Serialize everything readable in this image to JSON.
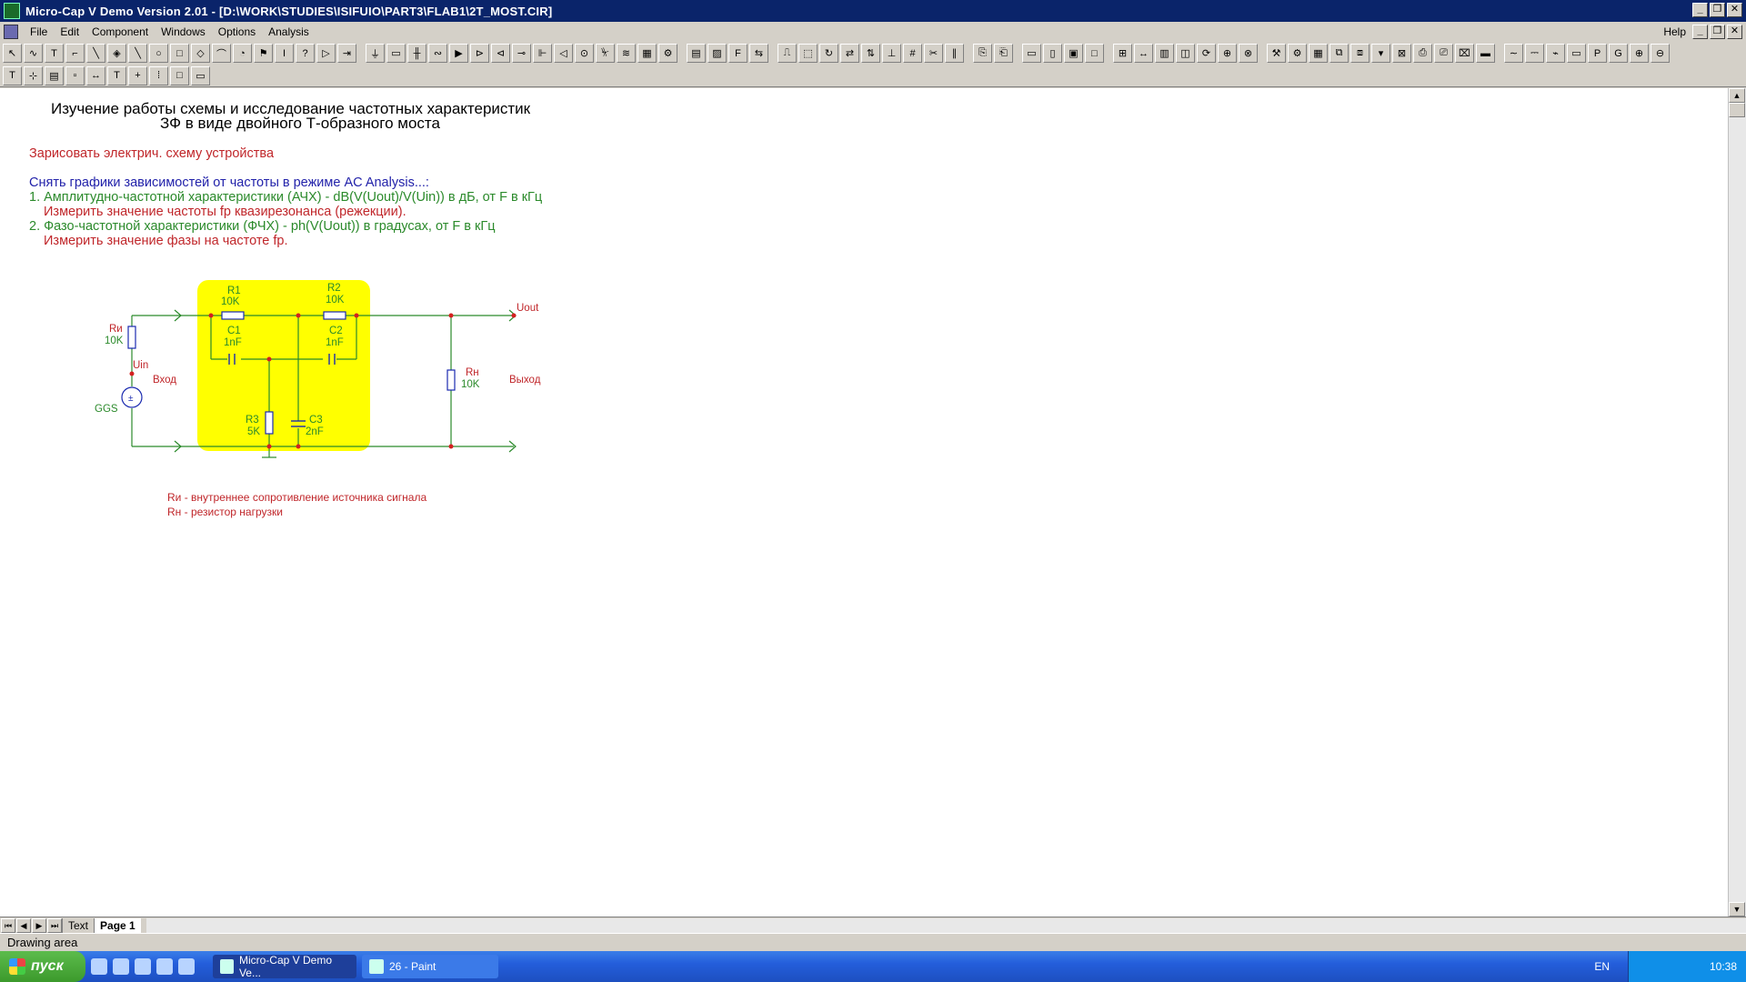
{
  "window": {
    "title": "Micro-Cap V Demo Version 2.01 - [D:\\WORK\\STUDIES\\ISIFUIO\\PART3\\FLAB1\\2T_MOST.CIR]"
  },
  "menu": {
    "items": [
      "File",
      "Edit",
      "Component",
      "Windows",
      "Options",
      "Analysis"
    ],
    "help": "Help"
  },
  "document": {
    "title_line1": "Изучение работы схемы и исследование частотных характеристик",
    "title_line2": "ЗФ в виде двойного Т-образного моста",
    "instruction_draw": "Зарисовать электрич. схему устройства",
    "instruction_graphs": "Снять графики зависимостей от частоты в режиме AC Analysis...:",
    "item1": "1. Амплитудно-частотной характеристики (АЧХ) - dB(V(Uout)/V(Uin)) в дБ, от F в кГц",
    "item1_sub": "Измерить значение частоты fр квазирезонанса (режекции).",
    "item2": "2. Фазо-частотной характеристики (ФЧХ) - ph(V(Uout)) в градусах, от F в кГц",
    "item2_sub": "Измерить значение фазы на частоте fр.",
    "note1": "Rи - внутреннее сопротивление источника сигнала",
    "note2": "Rн - резистор нагрузки"
  },
  "schematic": {
    "r1_name": "R1",
    "r1_value": "10K",
    "r2_name": "R2",
    "r2_value": "10K",
    "c1_name": "C1",
    "c1_value": "1nF",
    "c2_name": "C2",
    "c2_value": "1nF",
    "r3_name": "R3",
    "r3_value": "5K",
    "c3_name": "C3",
    "c3_value": "2nF",
    "ri_name": "Rи",
    "ri_value": "10K",
    "rn_name": "Rн",
    "rn_value": "10K",
    "uin": "Uin",
    "uout": "Uout",
    "vhod": "Вход",
    "vyhod": "Выход",
    "source": "GGS",
    "colors": {
      "wire": "#2b8a2b",
      "highlight": "#ffff00",
      "node": "#d42020",
      "component": "#1a2ab0",
      "label": "#2b8a2b"
    }
  },
  "tabs": {
    "text": "Text",
    "page": "Page 1"
  },
  "status": "Drawing area",
  "taskbar": {
    "start": "пуск",
    "task1": "Micro-Cap V Demo Ve...",
    "task2": "26 - Paint",
    "lang": "EN",
    "clock": "10:38"
  }
}
